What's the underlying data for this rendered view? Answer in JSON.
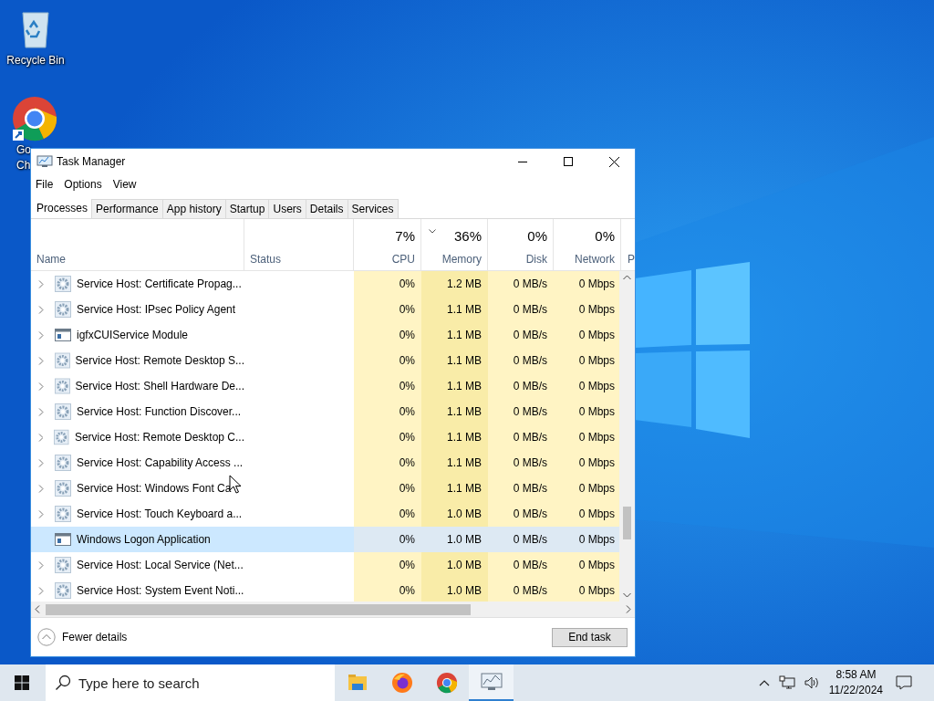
{
  "desktop_icons": [
    {
      "kind": "recycle",
      "label_lines": [
        "Recycle Bin"
      ]
    },
    {
      "kind": "chrome",
      "label_lines": [
        "Go",
        "Ch"
      ]
    }
  ],
  "window": {
    "title": "Task Manager",
    "menu": [
      "File",
      "Options",
      "View"
    ],
    "tabs": [
      {
        "label": "Processes",
        "selected": true
      },
      {
        "label": "Performance",
        "selected": false
      },
      {
        "label": "App history",
        "selected": false
      },
      {
        "label": "Startup",
        "selected": false
      },
      {
        "label": "Users",
        "selected": false
      },
      {
        "label": "Details",
        "selected": false
      },
      {
        "label": "Services",
        "selected": false
      }
    ],
    "columns": [
      {
        "label": "Name",
        "sorted": false
      },
      {
        "label": "Status",
        "sorted": false
      },
      {
        "percent": "7%",
        "label": "CPU",
        "sorted": false
      },
      {
        "percent": "36%",
        "label": "Memory",
        "sorted": true
      },
      {
        "percent": "0%",
        "label": "Disk",
        "sorted": false
      },
      {
        "percent": "0%",
        "label": "Network",
        "sorted": false
      },
      {
        "label": "P",
        "sorted": false
      }
    ],
    "rows": [
      {
        "name": "Service Host: Certificate Propag...",
        "kind": "gear",
        "expandable": true,
        "selected": false,
        "values": [
          "0%",
          "1.2 MB",
          "0 MB/s",
          "0 Mbps"
        ]
      },
      {
        "name": "Service Host: IPsec Policy Agent",
        "kind": "gear",
        "expandable": true,
        "selected": false,
        "values": [
          "0%",
          "1.1 MB",
          "0 MB/s",
          "0 Mbps"
        ]
      },
      {
        "name": "igfxCUIService Module",
        "kind": "window",
        "expandable": true,
        "selected": false,
        "values": [
          "0%",
          "1.1 MB",
          "0 MB/s",
          "0 Mbps"
        ]
      },
      {
        "name": "Service Host: Remote Desktop S...",
        "kind": "gear",
        "expandable": true,
        "selected": false,
        "values": [
          "0%",
          "1.1 MB",
          "0 MB/s",
          "0 Mbps"
        ]
      },
      {
        "name": "Service Host: Shell Hardware De...",
        "kind": "gear",
        "expandable": true,
        "selected": false,
        "values": [
          "0%",
          "1.1 MB",
          "0 MB/s",
          "0 Mbps"
        ]
      },
      {
        "name": "Service Host: Function Discover...",
        "kind": "gear",
        "expandable": true,
        "selected": false,
        "values": [
          "0%",
          "1.1 MB",
          "0 MB/s",
          "0 Mbps"
        ]
      },
      {
        "name": "Service Host: Remote Desktop C...",
        "kind": "gear",
        "expandable": true,
        "selected": false,
        "values": [
          "0%",
          "1.1 MB",
          "0 MB/s",
          "0 Mbps"
        ]
      },
      {
        "name": "Service Host: Capability Access ...",
        "kind": "gear",
        "expandable": true,
        "selected": false,
        "values": [
          "0%",
          "1.1 MB",
          "0 MB/s",
          "0 Mbps"
        ]
      },
      {
        "name": "Service Host: Windows Font Ca",
        "kind": "gear",
        "expandable": true,
        "selected": false,
        "values": [
          "0%",
          "1.1 MB",
          "0 MB/s",
          "0 Mbps"
        ]
      },
      {
        "name": "Service Host: Touch Keyboard a...",
        "kind": "gear",
        "expandable": true,
        "selected": false,
        "values": [
          "0%",
          "1.0 MB",
          "0 MB/s",
          "0 Mbps"
        ]
      },
      {
        "name": "Windows Logon Application",
        "kind": "window",
        "expandable": false,
        "selected": true,
        "values": [
          "0%",
          "1.0 MB",
          "0 MB/s",
          "0 Mbps"
        ]
      },
      {
        "name": "Service Host: Local Service (Net...",
        "kind": "gear",
        "expandable": true,
        "selected": false,
        "values": [
          "0%",
          "1.0 MB",
          "0 MB/s",
          "0 Mbps"
        ]
      },
      {
        "name": "Service Host: System Event Noti...",
        "kind": "gear",
        "expandable": true,
        "selected": false,
        "values": [
          "0%",
          "1.0 MB",
          "0 MB/s",
          "0 Mbps"
        ]
      }
    ],
    "fewer_details": "Fewer details",
    "end_task": "End task"
  },
  "taskbar": {
    "search_placeholder": "Type here to search",
    "apps": [
      {
        "kind": "explorer",
        "active": false
      },
      {
        "kind": "firefox",
        "active": false
      },
      {
        "kind": "chrome",
        "active": false
      },
      {
        "kind": "taskmanager",
        "active": true
      }
    ],
    "time": "8:58 AM",
    "date": "11/22/2024"
  }
}
